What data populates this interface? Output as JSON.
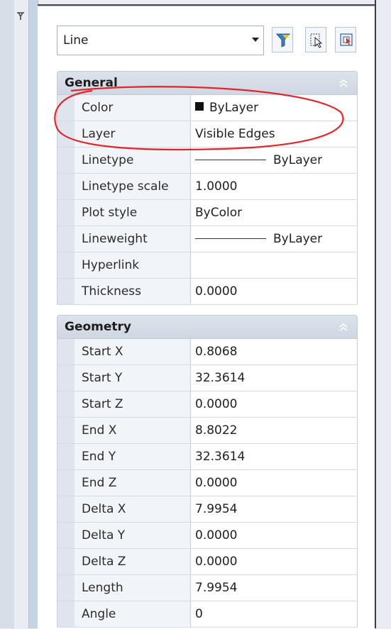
{
  "object_selector": {
    "value": "Line"
  },
  "toolbar": {
    "icons": [
      "toggle-pickadd-icon",
      "quick-select-icon",
      "select-objects-icon"
    ]
  },
  "sections": [
    {
      "title": "General",
      "rows": [
        {
          "name": "Color",
          "value": "ByLayer",
          "swatch": "#111111"
        },
        {
          "name": "Layer",
          "value": "Visible Edges"
        },
        {
          "name": "Linetype",
          "value": "ByLayer",
          "linepreview": true
        },
        {
          "name": "Linetype scale",
          "value": "1.0000"
        },
        {
          "name": "Plot style",
          "value": "ByColor"
        },
        {
          "name": "Lineweight",
          "value": "ByLayer",
          "linepreview": true
        },
        {
          "name": "Hyperlink",
          "value": ""
        },
        {
          "name": "Thickness",
          "value": "0.0000"
        }
      ]
    },
    {
      "title": "Geometry",
      "rows": [
        {
          "name": "Start X",
          "value": "0.8068"
        },
        {
          "name": "Start Y",
          "value": "32.3614"
        },
        {
          "name": "Start Z",
          "value": "0.0000"
        },
        {
          "name": "End X",
          "value": "8.8022"
        },
        {
          "name": "End Y",
          "value": "32.3614"
        },
        {
          "name": "End Z",
          "value": "0.0000"
        },
        {
          "name": "Delta X",
          "value": "7.9954"
        },
        {
          "name": "Delta Y",
          "value": "0.0000"
        },
        {
          "name": "Delta Z",
          "value": "0.0000"
        },
        {
          "name": "Length",
          "value": "7.9954"
        },
        {
          "name": "Angle",
          "value": "0"
        }
      ]
    }
  ],
  "annotation": {
    "color": "#e0262a"
  }
}
